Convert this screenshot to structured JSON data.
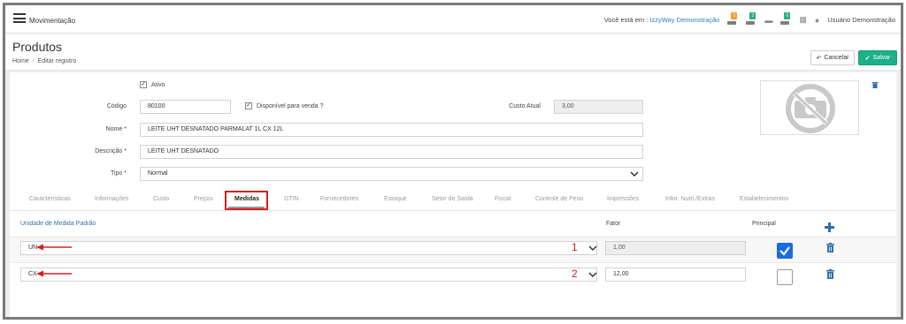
{
  "app": {
    "title": "Movimentação"
  },
  "topbar": {
    "company_prefix": "Você está em :",
    "company": "IzzyWay Demonstração",
    "badges": [
      "2",
      "3",
      "0"
    ],
    "user": "Usuário Demonstração"
  },
  "header": {
    "title": "Produtos",
    "breadcrumb": [
      "Home",
      "Editar registro"
    ],
    "cancel_label": "Cancelar",
    "save_label": "Salvar"
  },
  "form": {
    "ativo_label": "Ativo",
    "ativo_checked": true,
    "codigo_label": "Código",
    "codigo_value": "80100",
    "disponivel_label": "Disponível para venda ?",
    "disponivel_checked": true,
    "custo_label": "Custo Atual",
    "custo_value": "3,00",
    "nome_label": "Nome *",
    "nome_value": "LEITE UHT DESNATADO PARMALAT 1L CX 12L",
    "descricao_label": "Descrição *",
    "descricao_value": "LEITE UHT DESNATADO",
    "tipo_label": "Tipo *",
    "tipo_value": "Normal"
  },
  "tabs": [
    "Características",
    "Informações",
    "Custo",
    "Preços",
    "Medidas",
    "GTIN",
    "Fornecedores",
    "Estoque",
    "Setor de Saída",
    "Fiscal",
    "Controle de Peso",
    "Impressões",
    "Infor. Nutri./Extras",
    "Estabelecimentos"
  ],
  "active_tab": "Medidas",
  "medidas": {
    "col_unidade": "Unidade de Medida Padrão",
    "col_fator": "Fator",
    "col_principal": "Principal",
    "rows": [
      {
        "unidade": "UN",
        "marker": "1",
        "fator": "1,00",
        "principal": true
      },
      {
        "unidade": "CX",
        "marker": "2",
        "fator": "12,00",
        "principal": false
      }
    ]
  },
  "colors": {
    "accent": "#1cb08a",
    "link": "#2d7fb8",
    "annotation": "#d91e1e",
    "check": "#1a6de0"
  }
}
